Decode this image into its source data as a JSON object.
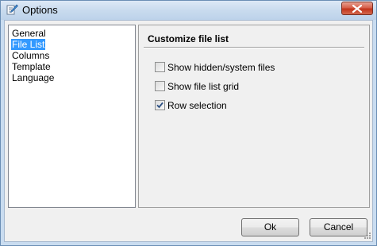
{
  "window": {
    "title": "Options",
    "icon": "options-pencil-icon"
  },
  "nav": {
    "items": [
      {
        "label": "General",
        "selected": false
      },
      {
        "label": "File List",
        "selected": true
      },
      {
        "label": "Columns",
        "selected": false
      },
      {
        "label": "Template",
        "selected": false
      },
      {
        "label": "Language",
        "selected": false
      }
    ]
  },
  "panel": {
    "header": "Customize file list",
    "options": [
      {
        "label": "Show hidden/system files",
        "checked": false
      },
      {
        "label": "Show file list grid",
        "checked": false
      },
      {
        "label": "Row selection",
        "checked": true
      }
    ]
  },
  "buttons": {
    "ok_label": "Ok",
    "cancel_label": "Cancel"
  },
  "colors": {
    "selection": "#3399ff",
    "title_gradient_top": "#dde9f6",
    "close_button": "#c2341b"
  }
}
